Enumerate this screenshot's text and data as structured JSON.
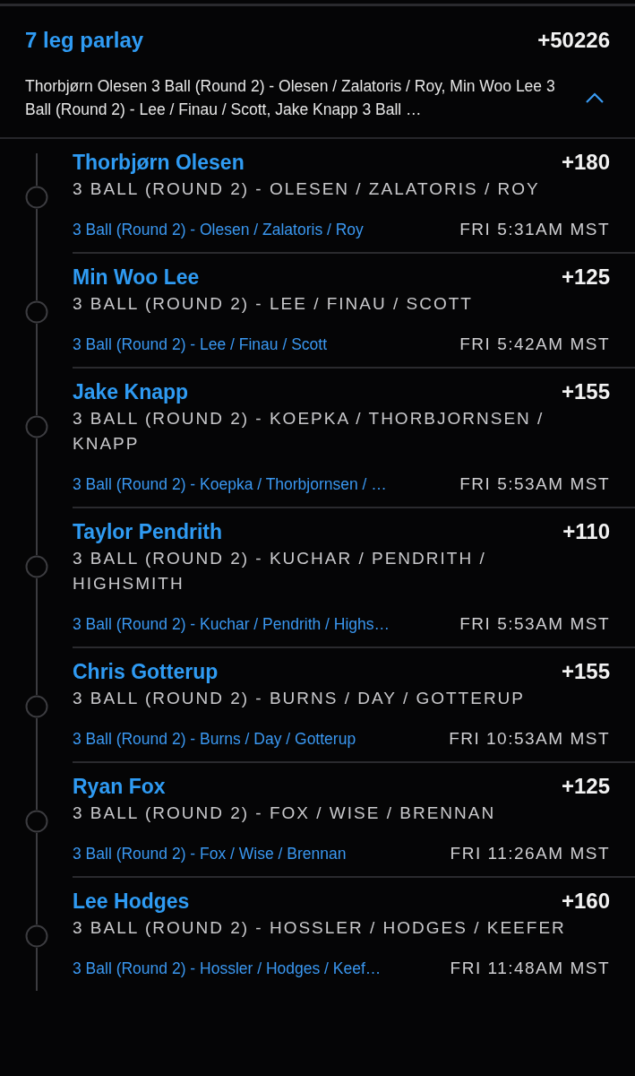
{
  "parlay": {
    "title": "7 leg parlay",
    "odds": "+50226",
    "description": "Thorbjørn Olesen 3 Ball (Round 2) - Olesen / Zalatoris / Roy, Min Woo Lee 3 Ball (Round 2) - Lee / Finau / Scott, Jake Knapp 3 Ball …",
    "expanded": true
  },
  "legs": [
    {
      "player": "Thorbjørn Olesen",
      "odds": "+180",
      "market": "3 BALL (ROUND 2) - OLESEN / ZALATORIS / ROY",
      "event": "3 Ball (Round 2) - Olesen / Zalatoris / Roy",
      "time": "FRI 5:31AM MST"
    },
    {
      "player": "Min Woo Lee",
      "odds": "+125",
      "market": "3 BALL (ROUND 2) - LEE / FINAU / SCOTT",
      "event": "3 Ball (Round 2) - Lee / Finau / Scott",
      "time": "FRI 5:42AM MST"
    },
    {
      "player": "Jake Knapp",
      "odds": "+155",
      "market": "3 BALL (ROUND 2) - KOEPKA / THORBJORNSEN / KNAPP",
      "event": "3 Ball (Round 2) - Koepka / Thorbjornsen / …",
      "time": "FRI 5:53AM MST"
    },
    {
      "player": "Taylor Pendrith",
      "odds": "+110",
      "market": "3 BALL (ROUND 2) - KUCHAR / PENDRITH / HIGHSMITH",
      "event": "3 Ball (Round 2) - Kuchar / Pendrith / Highs…",
      "time": "FRI 5:53AM MST"
    },
    {
      "player": "Chris Gotterup",
      "odds": "+155",
      "market": "3 BALL (ROUND 2) - BURNS / DAY / GOTTERUP",
      "event": "3 Ball (Round 2) - Burns / Day / Gotterup",
      "time": "FRI 10:53AM MST"
    },
    {
      "player": "Ryan Fox",
      "odds": "+125",
      "market": "3 BALL (ROUND 2) - FOX / WISE / BRENNAN",
      "event": "3 Ball (Round 2) - Fox / Wise / Brennan",
      "time": "FRI 11:26AM MST"
    },
    {
      "player": "Lee Hodges",
      "odds": "+160",
      "market": "3 BALL (ROUND 2) - HOSSLER / HODGES / KEEFER",
      "event": "3 Ball (Round 2) - Hossler / Hodges / Keef…",
      "time": "FRI 11:48AM MST"
    }
  ]
}
